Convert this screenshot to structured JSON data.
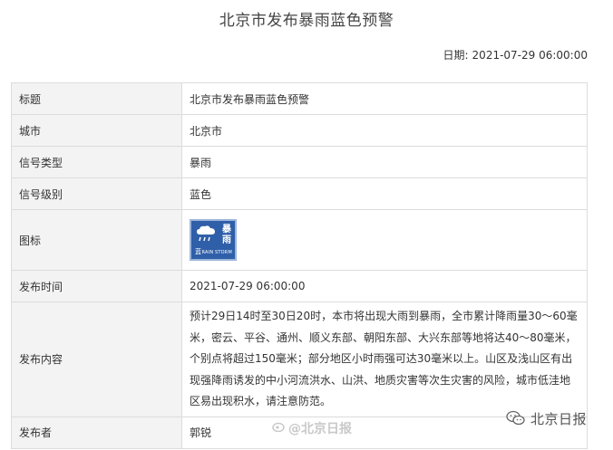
{
  "page": {
    "title": "北京市发布暴雨蓝色预警",
    "date_label": "日期:",
    "date_value": "2021-07-29 06:00:00"
  },
  "table": {
    "rows": [
      {
        "label": "标题",
        "value": "北京市发布暴雨蓝色预警"
      },
      {
        "label": "城市",
        "value": "北京市"
      },
      {
        "label": "信号类型",
        "value": "暴雨"
      },
      {
        "label": "信号级别",
        "value": "蓝色"
      },
      {
        "label": "图标",
        "icon": "rainstorm-blue-warning-icon"
      },
      {
        "label": "发布时间",
        "value": "2021-07-29 06:00:00"
      },
      {
        "label": "发布内容",
        "value": "预计29日14时至30日20时，本市将出现大雨到暴雨，全市累计降雨量30～60毫米，密云、平谷、通州、顺义东部、朝阳东部、大兴东部等地将达40～80毫米，个别点将超过150毫米；部分地区小时雨强可达30毫米以上。山区及浅山区有出现强降雨诱发的中小河流洪水、山洪、地质灾害等次生灾害的风险，城市低洼地区易出现积水，请注意防范。"
      },
      {
        "label": "发布者",
        "value": "郭锐"
      }
    ]
  },
  "icon_badge": {
    "char1": "暴",
    "char2": "雨",
    "level": "蓝",
    "english": "RAIN STORM",
    "color": "#2f5fa8"
  },
  "watermark": {
    "text": "@北京日报"
  },
  "wechat_badge": {
    "text": "北京日报",
    "icon": "wechat-icon"
  }
}
